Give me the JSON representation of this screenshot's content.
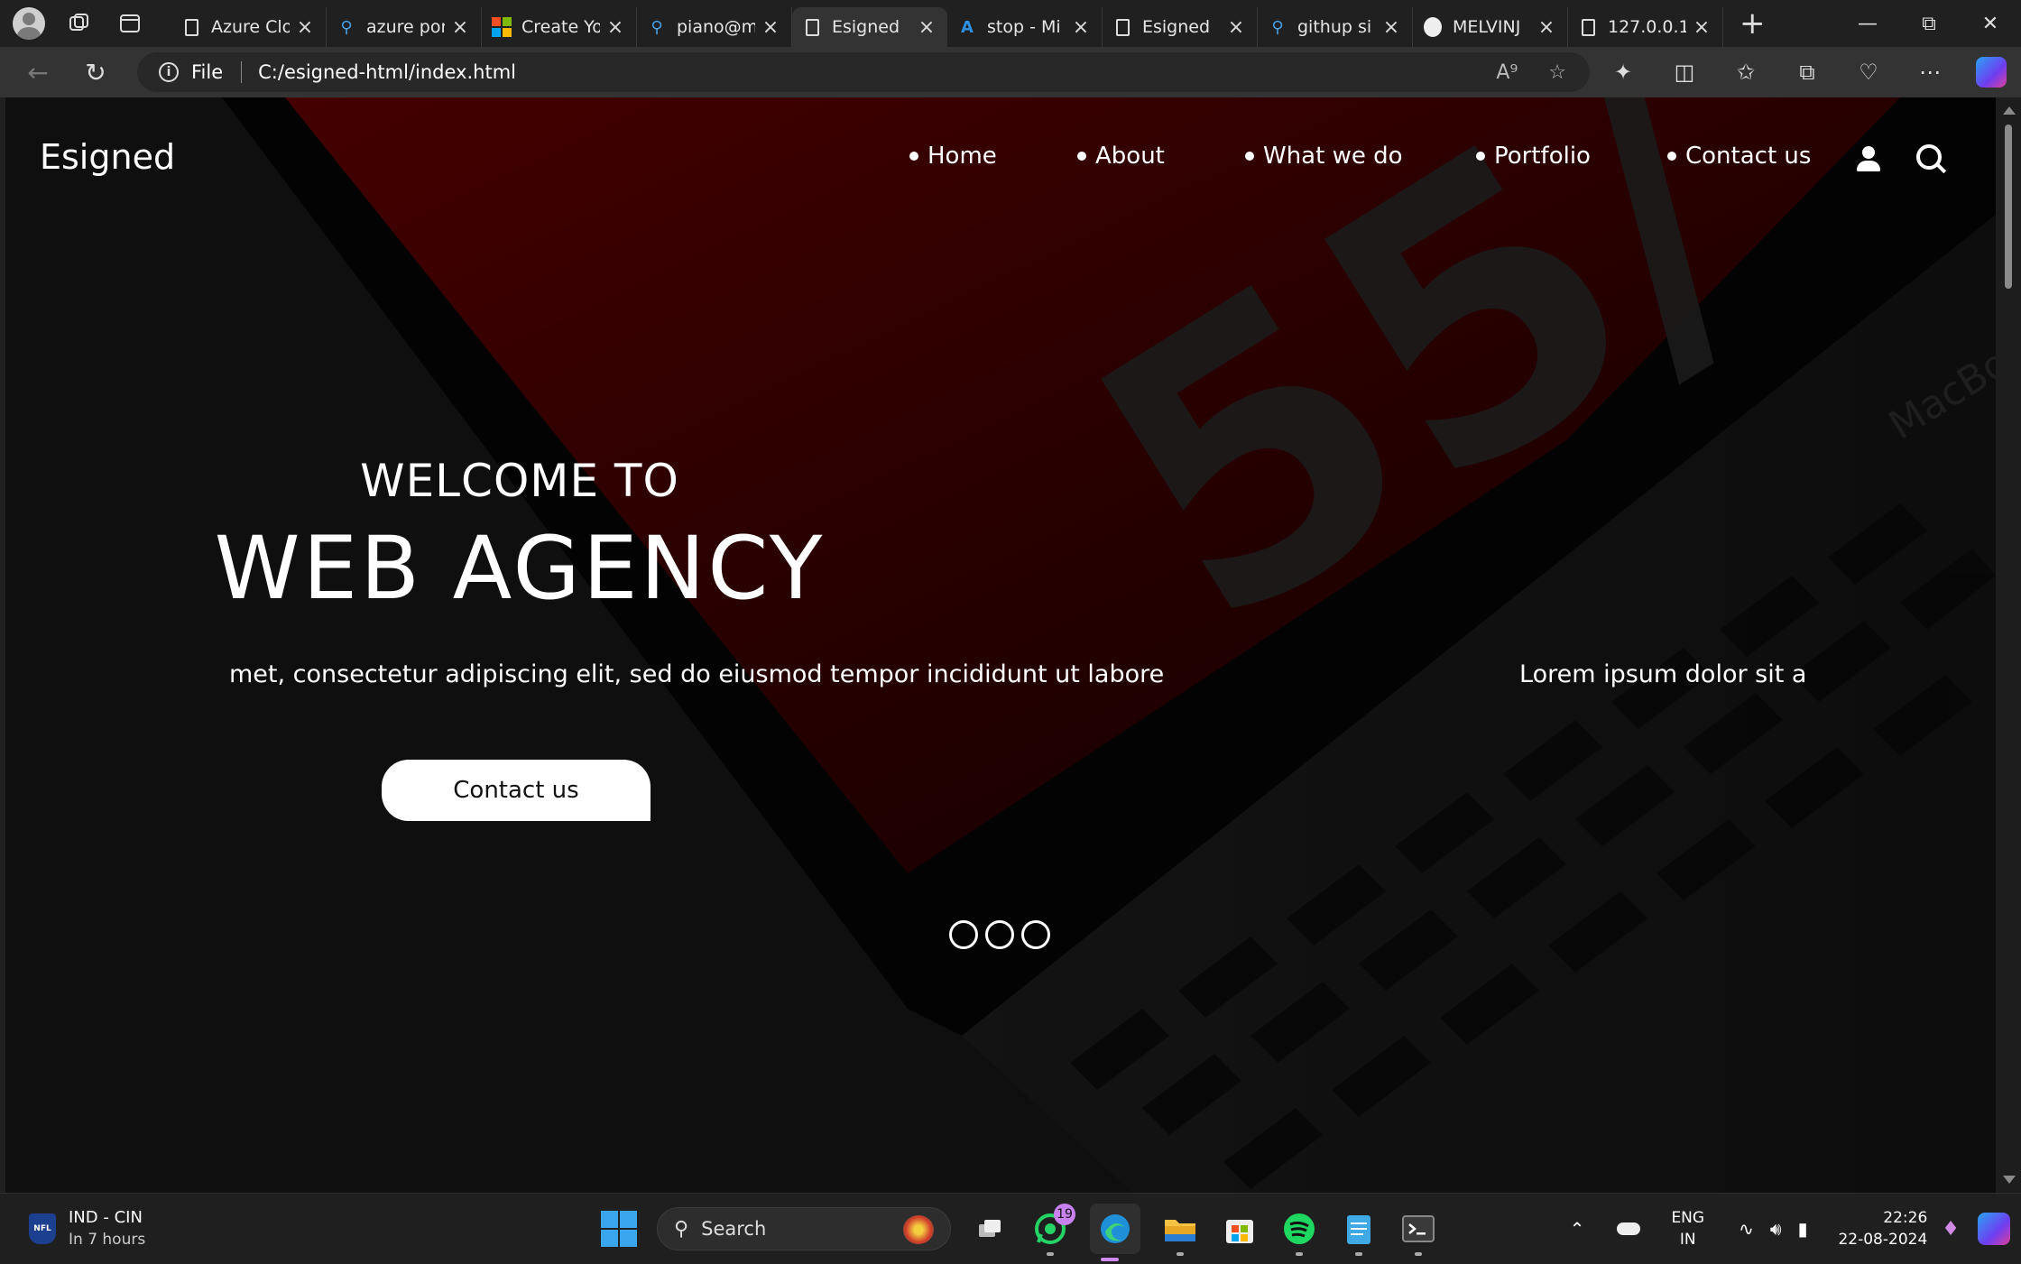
{
  "browser": {
    "tabs": [
      {
        "title": "Azure Clo",
        "icon": "document-icon"
      },
      {
        "title": "azure por",
        "icon": "search-icon"
      },
      {
        "title": "Create Yo",
        "icon": "microsoft-icon"
      },
      {
        "title": "piano@m",
        "icon": "search-icon"
      },
      {
        "title": "Esigned",
        "icon": "document-icon",
        "active": true
      },
      {
        "title": "stop - Mi",
        "icon": "azure-icon"
      },
      {
        "title": "Esigned",
        "icon": "document-icon"
      },
      {
        "title": "githup si",
        "icon": "search-icon"
      },
      {
        "title": "MELVINJ",
        "icon": "github-icon"
      },
      {
        "title": "127.0.0.1",
        "icon": "document-icon"
      }
    ],
    "address": {
      "scheme_label": "File",
      "url": "C:/esigned-html/index.html"
    }
  },
  "site": {
    "logo": "Esigned",
    "nav": [
      {
        "label": "Home"
      },
      {
        "label": "About"
      },
      {
        "label": "What we do"
      },
      {
        "label": "Portfolio"
      },
      {
        "label": "Contact us"
      }
    ],
    "hero": {
      "welcome": "WELCOME TO",
      "headline": "WEB AGENCY",
      "marquee_left": "met, consectetur adipiscing elit, sed do eiusmod tempor incididunt ut labore",
      "marquee_right": "Lorem ipsum dolor sit a",
      "cta_label": "Contact us",
      "slide_count": 3
    },
    "background_decor_text": "55/",
    "background_brand_text": "MacBo"
  },
  "taskbar": {
    "weather": {
      "title": "IND - CIN",
      "subtitle": "In 7 hours",
      "icon": "nfl-icon"
    },
    "search_label": "Search",
    "whatsapp_badge": "19",
    "language": {
      "line1": "ENG",
      "line2": "IN"
    },
    "clock": {
      "time": "22:26",
      "date": "22-08-2024"
    }
  },
  "colors": {
    "page_bg": "#151515",
    "hero_red": "#5a0000",
    "accent_blue": "#3aa6f0",
    "badge_purple": "#c981f0"
  }
}
